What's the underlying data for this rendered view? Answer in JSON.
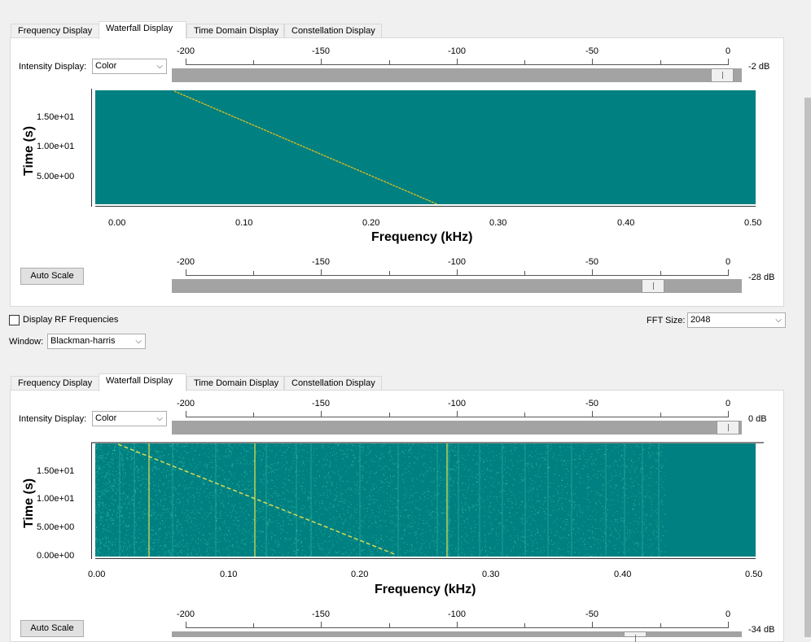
{
  "top": {
    "tabs": [
      "Frequency Display",
      "Waterfall Display",
      "Time Domain Display",
      "Constellation Display"
    ],
    "active_tab": 1,
    "intensity_label": "Intensity Display:",
    "intensity_value": "Color",
    "scale_labels": [
      "-200",
      "-150",
      "-100",
      "-50",
      "0"
    ],
    "upper_db": "-2 dB",
    "lower_db": "-28 dB",
    "auto_scale": "Auto Scale",
    "plot": {
      "y_ticks": [
        "1.50e+01",
        "1.00e+01",
        "5.00e+00"
      ],
      "x_ticks": [
        "0.00",
        "0.10",
        "0.20",
        "0.30",
        "0.40",
        "0.50"
      ],
      "ylabel": "Time (s)",
      "xlabel": "Frequency (kHz)",
      "colors": {
        "background": "#008080",
        "trace": "#e0c020"
      }
    }
  },
  "controls": {
    "display_rf_label": "Display RF Frequencies",
    "display_rf_checked": false,
    "fft_label": "FFT Size:",
    "fft_value": "2048",
    "window_label": "Window:",
    "window_value": "Blackman-harris"
  },
  "bottom": {
    "tabs": [
      "Frequency Display",
      "Waterfall Display",
      "Time Domain Display",
      "Constellation Display"
    ],
    "active_tab": 1,
    "intensity_label": "Intensity Display:",
    "intensity_value": "Color",
    "scale_labels": [
      "-200",
      "-150",
      "-100",
      "-50",
      "0"
    ],
    "upper_db": "0 dB",
    "lower_db": "-34 dB",
    "auto_scale": "Auto Scale",
    "plot": {
      "y_ticks": [
        "1.50e+01",
        "1.00e+01",
        "5.00e+00",
        "0.00e+00"
      ],
      "x_ticks": [
        "0.00",
        "0.10",
        "0.20",
        "0.30",
        "0.40",
        "0.50"
      ],
      "ylabel": "Time (s)",
      "xlabel": "Frequency (kHz)",
      "colors": {
        "background": "#008080",
        "noise": "#3cc8b4",
        "trace": "#e8e050"
      }
    }
  }
}
